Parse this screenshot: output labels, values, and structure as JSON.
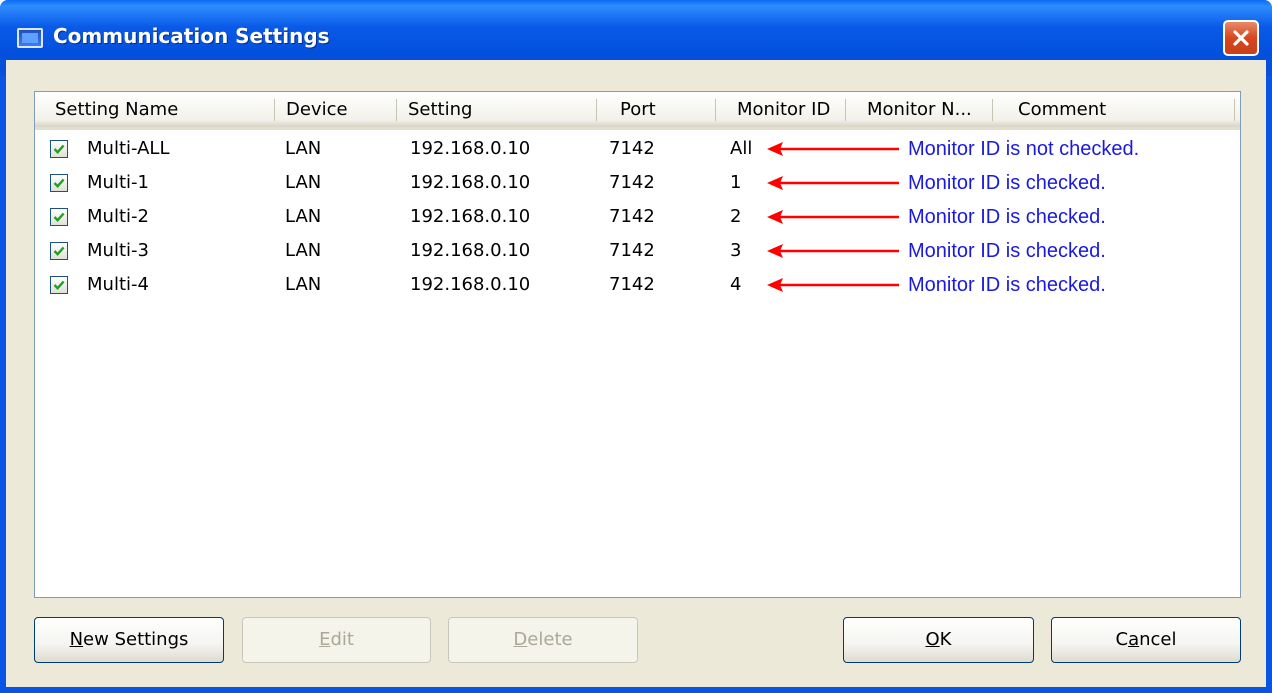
{
  "window": {
    "title": "Communication Settings"
  },
  "columns": [
    "Setting Name",
    "Device",
    "Setting",
    "Port",
    "Monitor ID",
    "Monitor N...",
    "Comment"
  ],
  "rows": [
    {
      "checked": true,
      "name": "Multi-ALL",
      "device": "LAN",
      "setting": "192.168.0.10",
      "port": "7142",
      "monitor_id": "All",
      "annotation": "Monitor ID is not checked."
    },
    {
      "checked": true,
      "name": "Multi-1",
      "device": "LAN",
      "setting": "192.168.0.10",
      "port": "7142",
      "monitor_id": "1",
      "annotation": "Monitor ID is checked."
    },
    {
      "checked": true,
      "name": "Multi-2",
      "device": "LAN",
      "setting": "192.168.0.10",
      "port": "7142",
      "monitor_id": "2",
      "annotation": "Monitor ID is checked."
    },
    {
      "checked": true,
      "name": "Multi-3",
      "device": "LAN",
      "setting": "192.168.0.10",
      "port": "7142",
      "monitor_id": "3",
      "annotation": "Monitor ID is checked."
    },
    {
      "checked": true,
      "name": "Multi-4",
      "device": "LAN",
      "setting": "192.168.0.10",
      "port": "7142",
      "monitor_id": "4",
      "annotation": "Monitor ID is checked."
    }
  ],
  "buttons": {
    "new_settings": {
      "label": "New Settings",
      "mnemonic": "N",
      "enabled": true
    },
    "edit": {
      "label": "Edit",
      "mnemonic": "E",
      "enabled": false
    },
    "delete": {
      "label": "Delete",
      "mnemonic": "D",
      "enabled": false
    },
    "ok": {
      "label": "OK",
      "mnemonic": "O",
      "enabled": true
    },
    "cancel": {
      "label": "Cancel",
      "mnemonic": "a",
      "enabled": true
    }
  },
  "icons": {
    "window": "window-icon",
    "close": "close-icon",
    "check": "checkmark-icon",
    "annotation_arrow": "red-arrow-icon"
  },
  "colors": {
    "title_bar": "#0a54e3",
    "annotation_text": "#1a1adf",
    "annotation_arrow": "#ff0000",
    "checkmark": "#21a121",
    "dialog_bg": "#ece9d8"
  }
}
